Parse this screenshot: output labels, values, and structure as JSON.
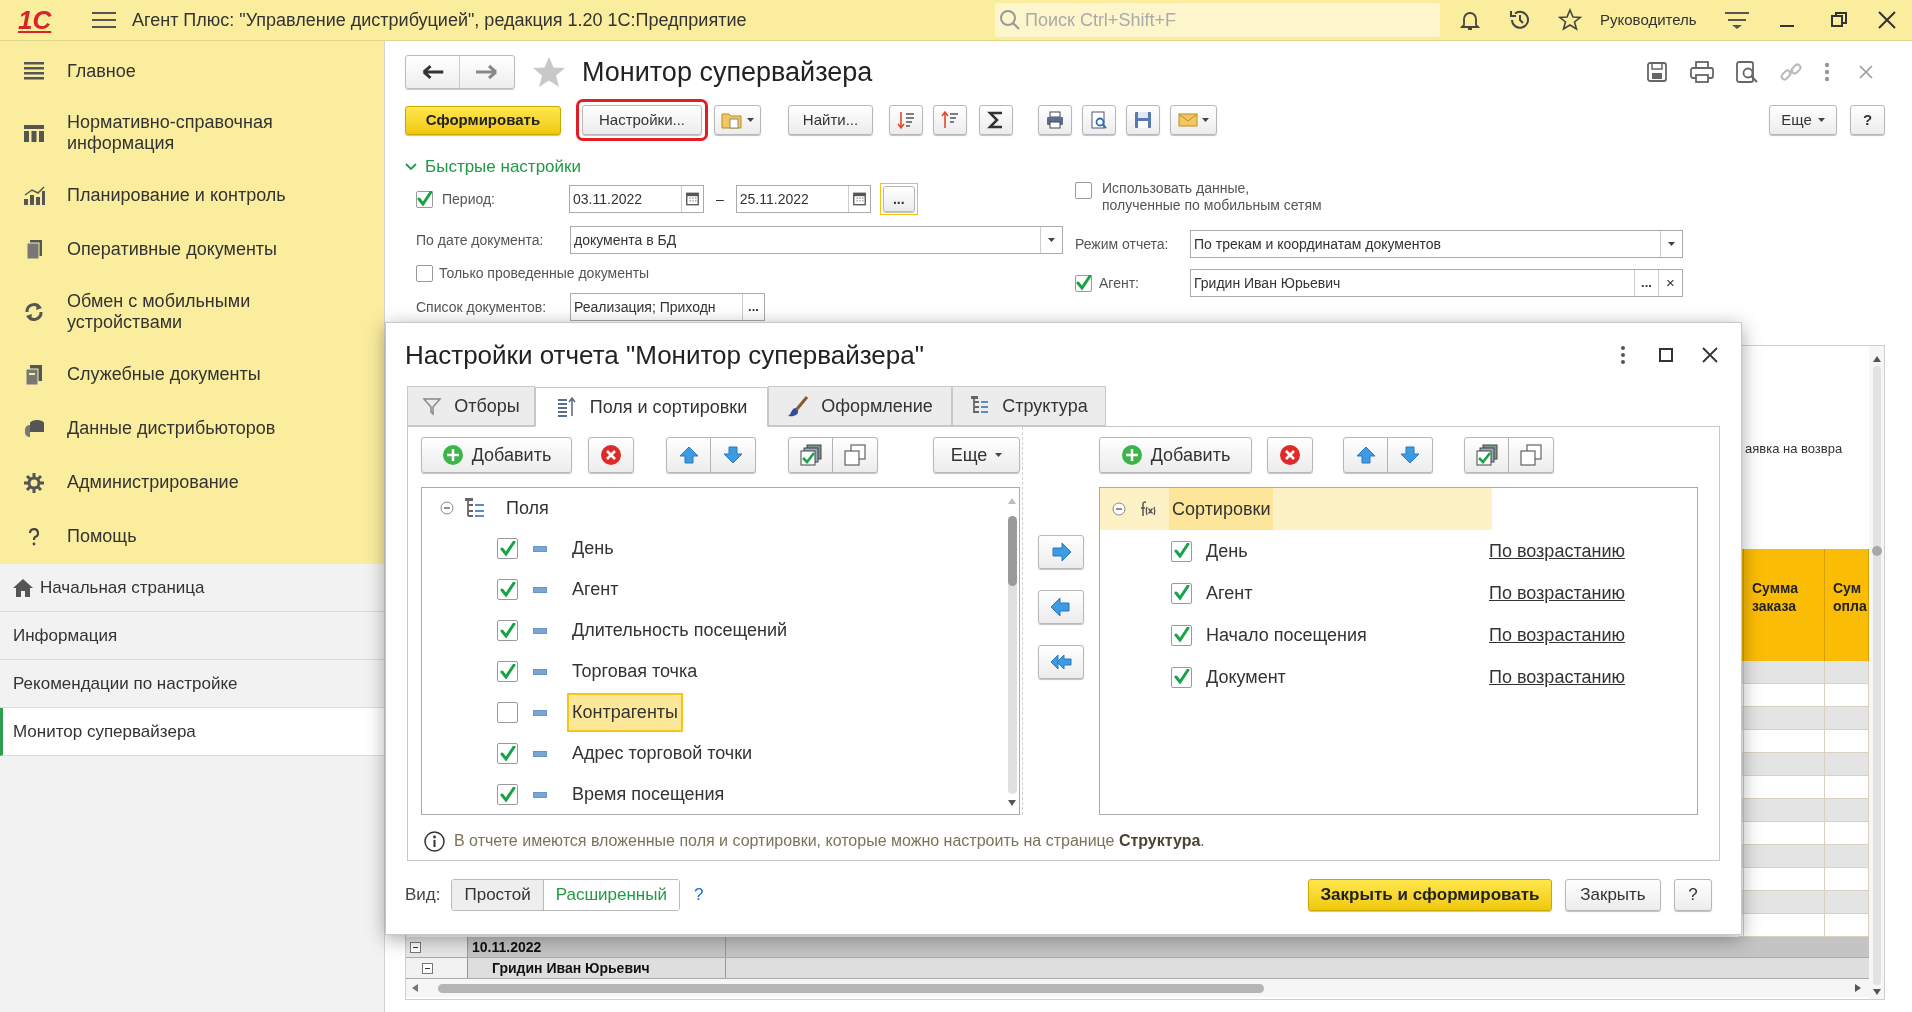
{
  "app_bar": {
    "logo": "1С",
    "title": "Агент Плюс: \"Управление дистрибуцией\", редакция 1.20 1С:Предприятие",
    "search": {
      "placeholder": "Поиск Ctrl+Shift+F"
    },
    "user": "Руководитель"
  },
  "sidebar": {
    "sections": [
      {
        "label": "Главное"
      },
      {
        "label": "Нормативно-справочная\nинформация"
      },
      {
        "label": "Планирование и контроль"
      },
      {
        "label": "Оперативные документы"
      },
      {
        "label": "Обмен с мобильными\nустройствами"
      },
      {
        "label": "Служебные документы"
      },
      {
        "label": "Данные дистрибьюторов"
      },
      {
        "label": "Администрирование"
      },
      {
        "label": "Помощь"
      }
    ],
    "pages": [
      {
        "label": "Начальная страница",
        "selected": false
      },
      {
        "label": "Информация",
        "selected": false
      },
      {
        "label": "Рекомендации по настройке",
        "selected": false
      },
      {
        "label": "Монитор супервайзера",
        "selected": true
      }
    ]
  },
  "form": {
    "title": "Монитор супервайзера",
    "toolbar": {
      "generate": "Сформировать",
      "settings": "Настройки...",
      "find": "Найти...",
      "more": "Еще",
      "help": "?"
    },
    "quick_settings": {
      "title": "Быстрые настройки",
      "expanded": true,
      "period": {
        "checked": true,
        "label": "Период:",
        "from": "03.11.2022",
        "separator": "–",
        "to": "25.11.2022",
        "more": "..."
      },
      "by_date": {
        "label": "По дате документа:",
        "value": "документа в БД"
      },
      "posted_only": {
        "checked": false,
        "label": "Только проведенные документы"
      },
      "doc_list": {
        "label": "Список документов:",
        "value": "Реализация; Приходн",
        "more": "..."
      },
      "mobile_data": {
        "checked": false,
        "label": "Использовать данные,\nполученные по мобильным сетям"
      },
      "report_mode": {
        "label": "Режим отчета:",
        "value": "По трекам и координатам документов"
      },
      "agent": {
        "checked": true,
        "label": "Агент:",
        "value": "Гридин Иван Юрьевич",
        "more": "...",
        "clear": "×"
      }
    },
    "report": {
      "partial_text": "аявка на возвра",
      "columns": [
        "Сумма заказа",
        "Сум опла"
      ],
      "groups": [
        {
          "label": "10.11.2022"
        },
        {
          "label": "Гридин Иван Юрьевич"
        }
      ]
    }
  },
  "dialog": {
    "title": "Настройки отчета \"Монитор супервайзера\"",
    "tabs": [
      {
        "label": "Отборы",
        "selected": false
      },
      {
        "label": "Поля и сортировки",
        "selected": true
      },
      {
        "label": "Оформление",
        "selected": false
      },
      {
        "label": "Структура",
        "selected": false
      }
    ],
    "fields": {
      "add": "Добавить",
      "more": "Еще",
      "root": "Поля",
      "expanded": true,
      "items": [
        {
          "label": "День",
          "checked": true,
          "selected": false
        },
        {
          "label": "Агент",
          "checked": true,
          "selected": false
        },
        {
          "label": "Длительность посещений",
          "checked": true,
          "selected": false
        },
        {
          "label": "Торговая точка",
          "checked": true,
          "selected": false
        },
        {
          "label": "Контрагенты",
          "checked": false,
          "selected": true
        },
        {
          "label": "Адрес торговой точки",
          "checked": true,
          "selected": false
        },
        {
          "label": "Время посещения",
          "checked": true,
          "selected": false
        }
      ]
    },
    "sorting": {
      "add": "Добавить",
      "root": "Сортировки",
      "expanded": true,
      "items": [
        {
          "label": "День",
          "checked": true,
          "direction": "По возрастанию"
        },
        {
          "label": "Агент",
          "checked": true,
          "direction": "По возрастанию"
        },
        {
          "label": "Начало посещения",
          "checked": true,
          "direction": "По возрастанию"
        },
        {
          "label": "Документ",
          "checked": true,
          "direction": "По возрастанию"
        }
      ]
    },
    "info": "В отчете имеются вложенные поля и сортировки, которые можно настроить на странице **Структура**.",
    "view": {
      "label": "Вид:",
      "options": [
        {
          "label": "Простой",
          "selected": false
        },
        {
          "label": "Расширенный",
          "selected": true
        }
      ],
      "help": "?"
    },
    "buttons": {
      "primary": "Закрыть и сформировать",
      "close": "Закрыть",
      "help": "?"
    }
  }
}
